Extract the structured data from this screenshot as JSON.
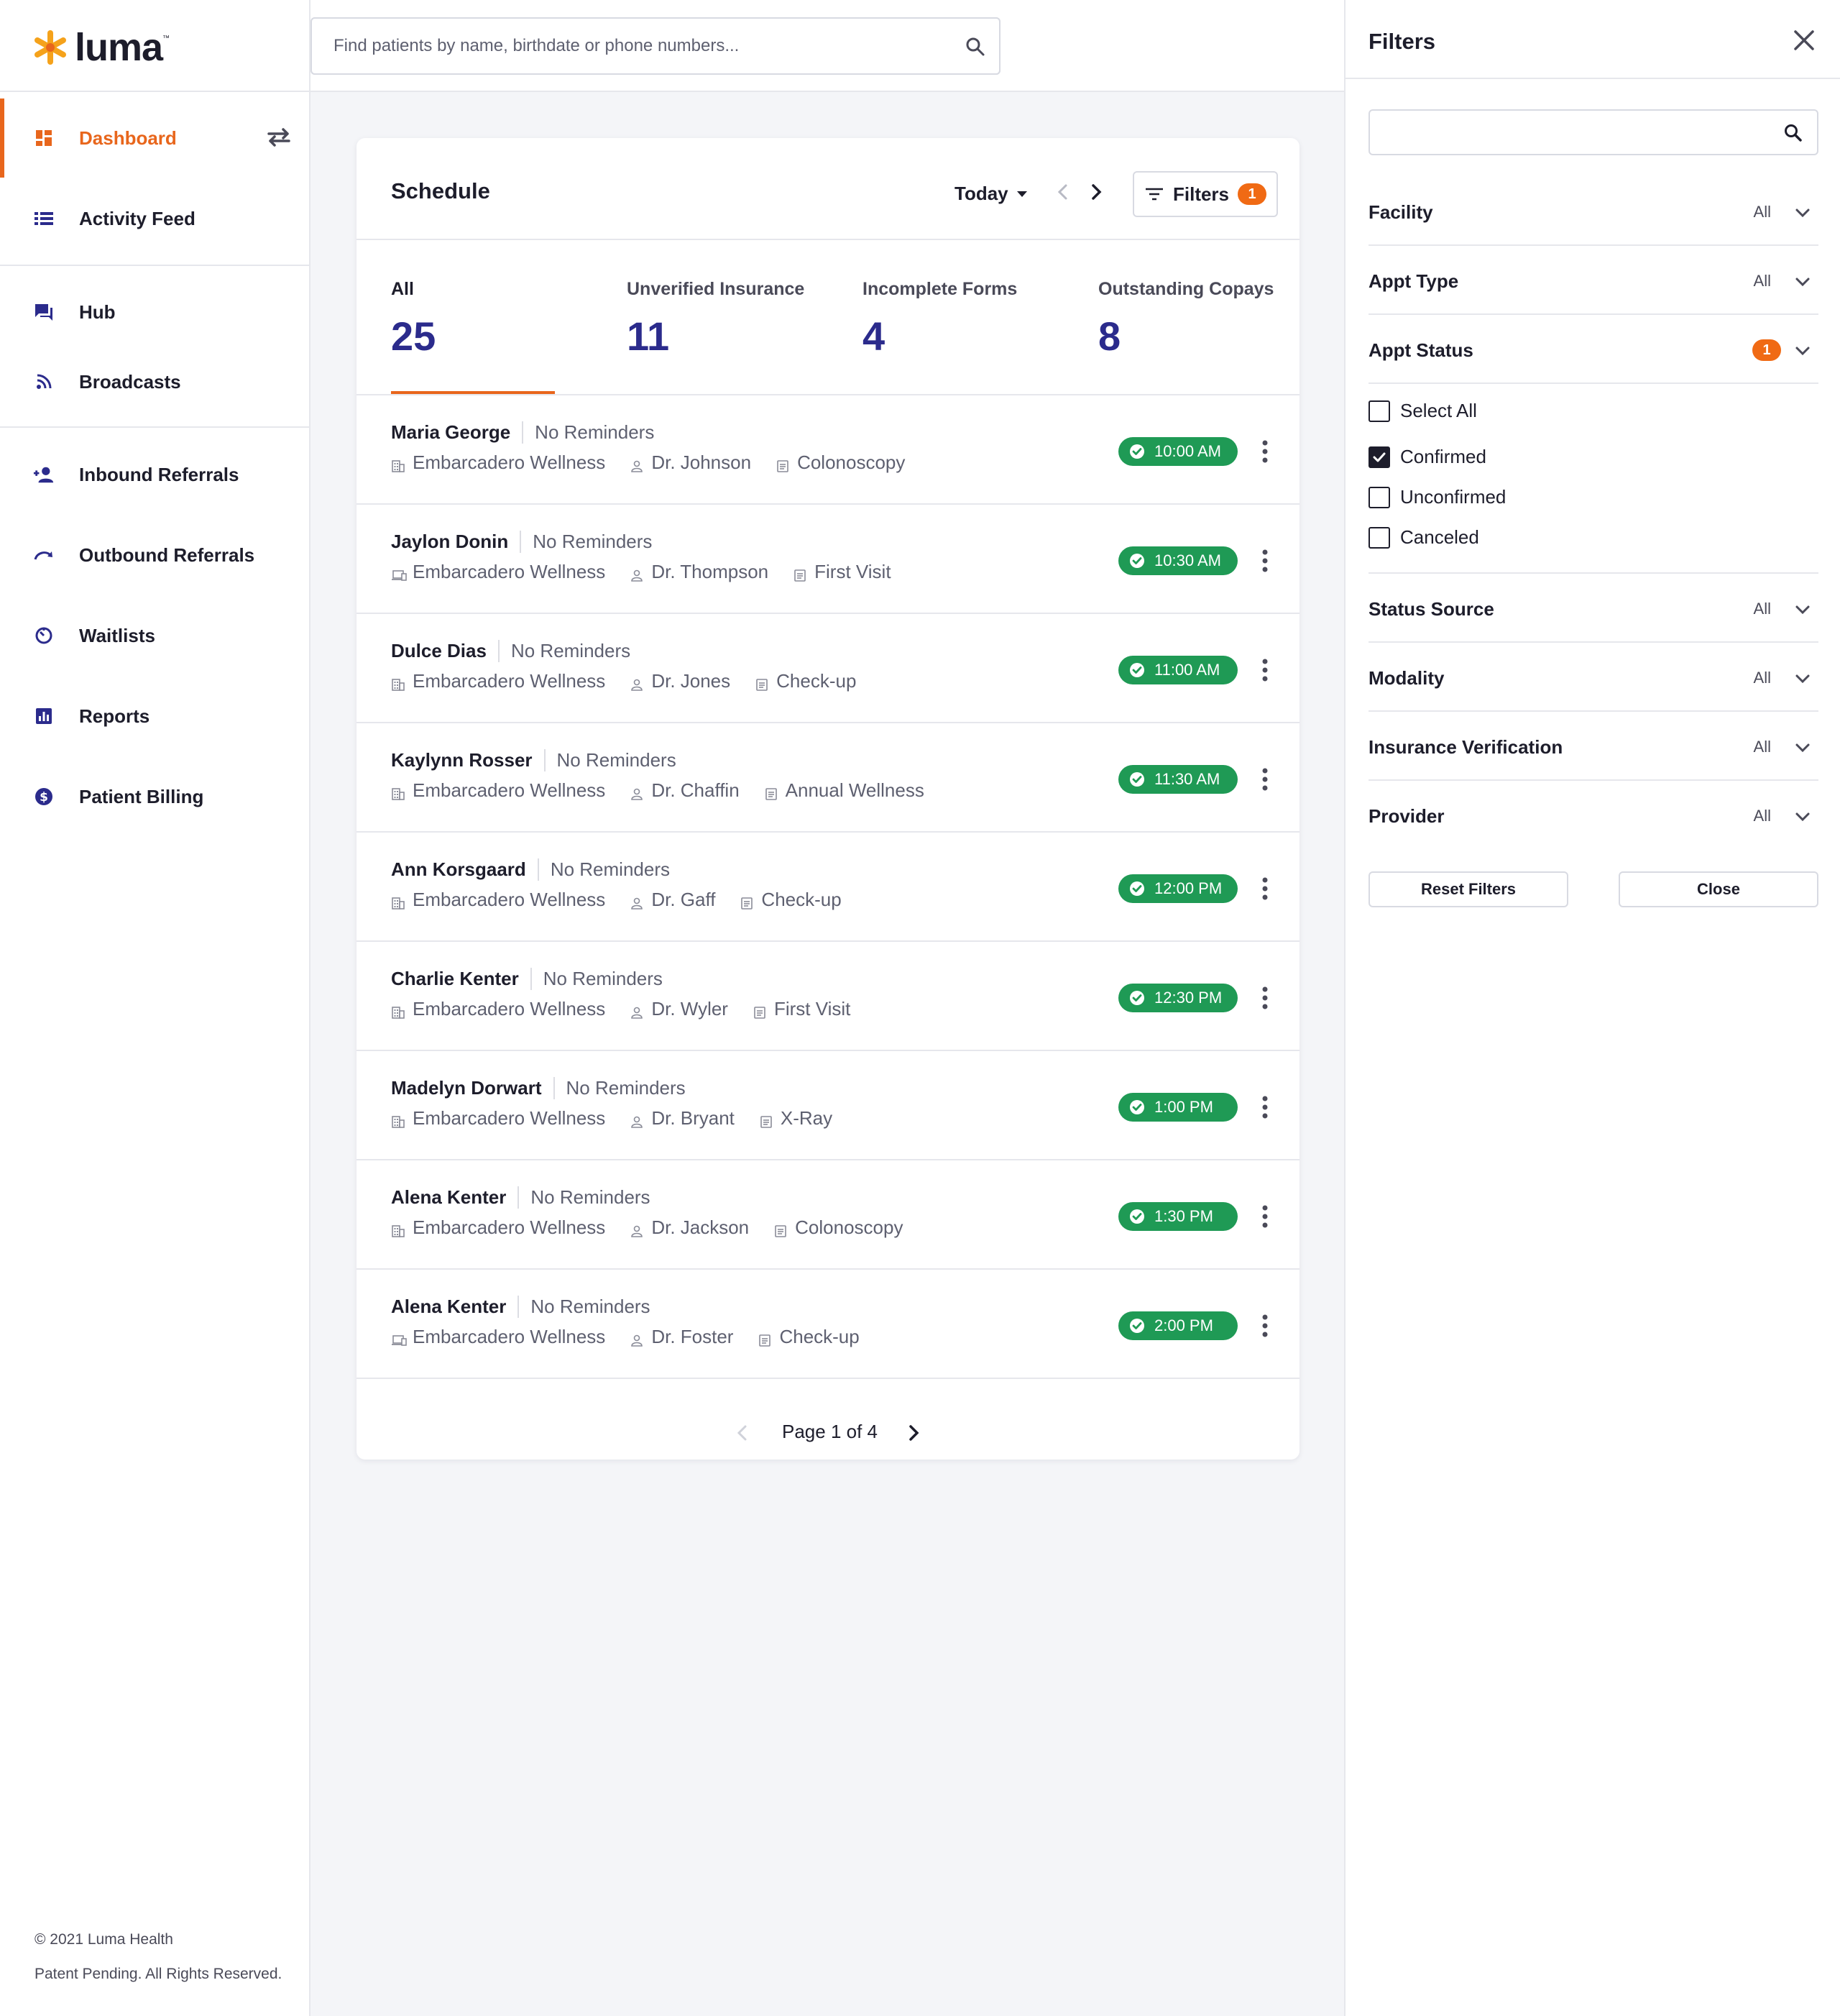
{
  "brand": {
    "name": "luma",
    "trademark": "™",
    "accent": "#e8661c",
    "primary": "#2b2b8c",
    "success": "#1f9a55"
  },
  "search": {
    "placeholder": "Find patients by name, birthdate or phone numbers..."
  },
  "sidebar": {
    "items": [
      {
        "label": "Dashboard",
        "icon": "dashboard-icon",
        "active": true
      },
      {
        "label": "Activity Feed",
        "icon": "list-icon"
      },
      {
        "label": "Hub",
        "icon": "chat-icon"
      },
      {
        "label": "Broadcasts",
        "icon": "rss-icon"
      },
      {
        "label": "Inbound Referrals",
        "icon": "person-add-icon"
      },
      {
        "label": "Outbound Referrals",
        "icon": "redo-icon"
      },
      {
        "label": "Waitlists",
        "icon": "timer-icon"
      },
      {
        "label": "Reports",
        "icon": "bar-chart-icon"
      },
      {
        "label": "Patient Billing",
        "icon": "dollar-icon"
      }
    ],
    "footer": {
      "copyright": "© 2021 Luma Health",
      "rights": "Patent Pending. All Rights Reserved."
    }
  },
  "schedule": {
    "title": "Schedule",
    "range": "Today",
    "filters_label": "Filters",
    "filters_count": "1",
    "stats": [
      {
        "label": "All",
        "value": "25"
      },
      {
        "label": "Unverified Insurance",
        "value": "11"
      },
      {
        "label": "Incomplete Forms",
        "value": "4"
      },
      {
        "label": "Outstanding Copays",
        "value": "8"
      }
    ],
    "rows": [
      {
        "name": "Maria George",
        "reminders": "No Reminders",
        "facility": "Embarcadero Wellness",
        "facility_icon": "building-icon",
        "provider": "Dr. Johnson",
        "type": "Colonoscopy",
        "time": "10:00 AM"
      },
      {
        "name": "Jaylon Donin",
        "reminders": "No Reminders",
        "facility": "Embarcadero Wellness",
        "facility_icon": "laptop-icon",
        "provider": "Dr. Thompson",
        "type": "First Visit",
        "time": "10:30 AM"
      },
      {
        "name": "Dulce Dias",
        "reminders": "No Reminders",
        "facility": "Embarcadero Wellness",
        "facility_icon": "building-icon",
        "provider": "Dr. Jones",
        "type": "Check-up",
        "time": "11:00 AM"
      },
      {
        "name": "Kaylynn Rosser",
        "reminders": "No Reminders",
        "facility": "Embarcadero Wellness",
        "facility_icon": "building-icon",
        "provider": "Dr. Chaffin",
        "type": "Annual Wellness",
        "time": "11:30 AM"
      },
      {
        "name": "Ann Korsgaard",
        "reminders": "No Reminders",
        "facility": "Embarcadero Wellness",
        "facility_icon": "building-icon",
        "provider": "Dr. Gaff",
        "type": "Check-up",
        "time": "12:00 PM"
      },
      {
        "name": "Charlie Kenter",
        "reminders": "No Reminders",
        "facility": "Embarcadero Wellness",
        "facility_icon": "building-icon",
        "provider": "Dr. Wyler",
        "type": "First Visit",
        "time": "12:30 PM"
      },
      {
        "name": "Madelyn Dorwart",
        "reminders": "No Reminders",
        "facility": "Embarcadero Wellness",
        "facility_icon": "building-icon",
        "provider": "Dr. Bryant",
        "type": "X-Ray",
        "time": "1:00 PM"
      },
      {
        "name": "Alena Kenter",
        "reminders": "No Reminders",
        "facility": "Embarcadero Wellness",
        "facility_icon": "building-icon",
        "provider": "Dr. Jackson",
        "type": "Colonoscopy",
        "time": "1:30 PM"
      },
      {
        "name": "Alena Kenter",
        "reminders": "No Reminders",
        "facility": "Embarcadero Wellness",
        "facility_icon": "laptop-icon",
        "provider": "Dr. Foster",
        "type": "Check-up",
        "time": "2:00 PM"
      }
    ],
    "pagination": "Page 1 of 4"
  },
  "filters": {
    "title": "Filters",
    "search_value": "",
    "facets": [
      {
        "label": "Facility",
        "value": "All"
      },
      {
        "label": "Appt Type",
        "value": "All"
      },
      {
        "label": "Appt Status",
        "badge": "1"
      },
      {
        "label": "Status Source",
        "value": "All"
      },
      {
        "label": "Modality",
        "value": "All"
      },
      {
        "label": "Insurance Verification",
        "value": "All"
      },
      {
        "label": "Provider",
        "value": "All"
      }
    ],
    "status_options": [
      {
        "label": "Select All",
        "checked": false
      },
      {
        "label": "Confirmed",
        "checked": true
      },
      {
        "label": "Unconfirmed",
        "checked": false
      },
      {
        "label": "Canceled",
        "checked": false
      }
    ],
    "reset_label": "Reset Filters",
    "close_label": "Close"
  }
}
